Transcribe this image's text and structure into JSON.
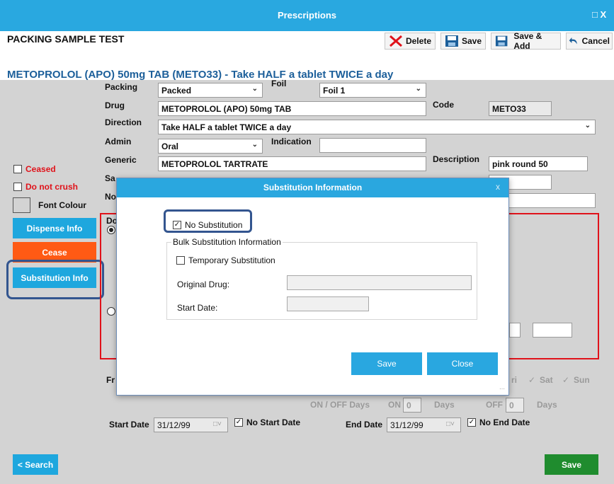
{
  "window": {
    "title": "Prescriptions",
    "controls": "□ X"
  },
  "page": {
    "title": "PACKING SAMPLE TEST",
    "drug_heading": "METOPROLOL (APO) 50mg TAB (METO33) - Take HALF a tablet TWICE a day"
  },
  "toolbar": {
    "delete": "Delete",
    "save": "Save",
    "save_add": "Save & Add",
    "cancel": "Cancel"
  },
  "form": {
    "packing_label": "Packing",
    "packing_value": "Packed",
    "foil_label": "Foil",
    "foil_value": "Foil 1",
    "drug_label": "Drug",
    "drug_value": "METOPROLOL (APO) 50mg TAB",
    "code_label": "Code",
    "code_value": "METO33",
    "direction_label": "Direction",
    "direction_value": "Take HALF a tablet TWICE a day",
    "admin_label": "Admin",
    "admin_value": "Oral",
    "indication_label": "Indication",
    "indication_value": "",
    "generic_label": "Generic",
    "generic_value": "METOPROLOL TARTRATE",
    "description_label": "Description",
    "description_value": "pink round 50",
    "sa_label": "Sa",
    "no_label": "No",
    "do_label": "Do",
    "fr_label": "Fr",
    "onoff_label": "ON / OFF Days",
    "on_label": "ON",
    "on_value": "0",
    "days1": "Days",
    "off_label": "OFF",
    "off_value": "0",
    "days2": "Days",
    "ri_label": "ri",
    "sat_label": "Sat",
    "sun_label": "Sun",
    "start_date_label": "Start Date",
    "start_date_value": "31/12/99",
    "no_start_date": "No Start Date",
    "end_date_label": "End Date",
    "end_date_value": "31/12/99",
    "no_end_date": "No End Date"
  },
  "sidebar": {
    "ceased": "Ceased",
    "do_not_crush": "Do not crush",
    "font_colour": "Font Colour",
    "dispense_info": "Dispense Info",
    "cease": "Cease",
    "substitution_info": "Substitution Info"
  },
  "bottom": {
    "search": "< Search",
    "save": "Save"
  },
  "modal": {
    "title": "Substitution Information",
    "close_x": "x",
    "no_substitution": "No Substitution",
    "group_title": "Bulk Substitution Information",
    "temporary_substitution": "Temporary Substitution",
    "original_drug_label": "Original Drug:",
    "original_drug_value": "",
    "start_date_label": "Start Date:",
    "start_date_value": "",
    "save": "Save",
    "close": "Close"
  },
  "colors": {
    "accent": "#29a8e0",
    "cease": "#ff5a14",
    "save_green": "#1f8c2e",
    "heading_blue": "#1c5f9a",
    "highlight": "#33558f",
    "ceased_red": "#e0121a"
  }
}
